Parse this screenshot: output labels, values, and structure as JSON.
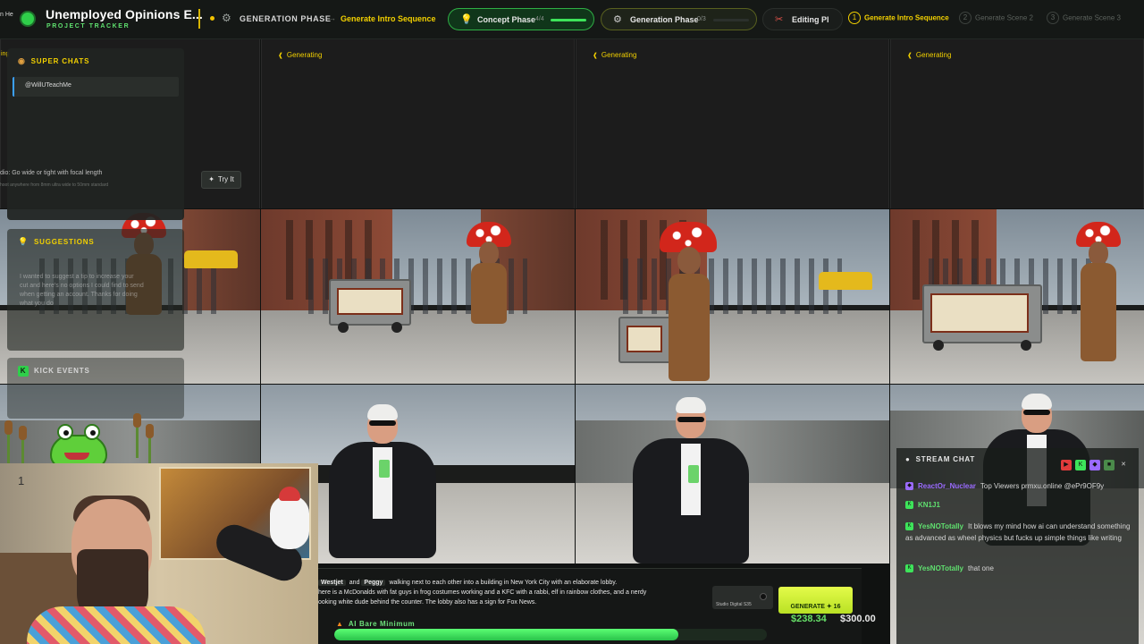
{
  "app": {
    "title": "Unemployed Opinions E...",
    "subtitle": "PROJECT TRACKER"
  },
  "topbar": {
    "phase_label": "GENERATION PHASE",
    "current_action": "Generate Intro Sequence",
    "pills": [
      {
        "label": "Concept Phase",
        "count": "4/4",
        "progress": 1.0
      },
      {
        "label": "Generation Phase",
        "count": "0/3",
        "progress": 0.0
      },
      {
        "label": "Editing Pl",
        "count": "",
        "progress": 0.0
      }
    ],
    "steps": [
      {
        "num": "1",
        "label": "Generate Intro Sequence",
        "state": "active"
      },
      {
        "num": "2",
        "label": "Generate Scene 2",
        "state": "idle"
      },
      {
        "num": "3",
        "label": "Generate Scene 3",
        "state": "idle"
      }
    ],
    "left_crumb": "n He"
  },
  "grid": {
    "generating_label": "Generating",
    "left_status": "ing"
  },
  "super_chats": {
    "title": "SUPER CHATS",
    "entries": [
      {
        "user": "@WillUTeachMe"
      }
    ]
  },
  "tip": {
    "text": "dio: Go wide or tight with focal length",
    "subtext": "hoot anywhere from 8mm ultra wide to 50mm standard",
    "try_label": "Try It"
  },
  "suggestions": {
    "title": "SUGGESTIONS",
    "lines": [
      "I wanted to suggest a tip to increase your",
      "cut and here's no options I could find to send",
      "when getting an account. Thanks for doing",
      "what you do"
    ]
  },
  "kick_events": {
    "title": "KICK EVENTS"
  },
  "webcam": {
    "overlay_digit": "1"
  },
  "chat": {
    "title": "STREAM CHAT",
    "messages": [
      {
        "platform": "twitch",
        "user": "ReactOr_Nuclear",
        "text": "Top Viewers prmxu.online @ePr9OF9y",
        "user_color": "#9b6bff"
      },
      {
        "platform": "kick",
        "user": "KN1J1",
        "text": "",
        "user_color": "#5fe06f"
      },
      {
        "platform": "kick",
        "user": "YesNOTotally",
        "text": "It blows my mind how ai can understand something as advanced as wheel physics but fucks up simple things like writing",
        "user_color": "#5fe06f"
      },
      {
        "platform": "kick",
        "user": "YesNOTotally",
        "text": "that one",
        "user_color": "#5fe06f"
      }
    ]
  },
  "prompt": {
    "mention_1": "Westjet",
    "joiner": "and",
    "mention_2": "Peggy",
    "line_1": "walking next to each other into a building in New York City with an elaborate lobby.",
    "line_2": "here is a McDonalds with fat guys in frog costumes working and a KFC with a rabbi, elf in rainbow clothes, and a nerdy",
    "line_3": "ooking white dude behind the counter. The lobby also has a sign for Fox News.",
    "model_label": "Studio Digital S35",
    "generate_label": "GENERATE",
    "generate_cost": "16"
  },
  "budget": {
    "name": "AI Bare Minimum",
    "spent": "$238.34",
    "total": "$300.00",
    "spent_value": 238.34,
    "total_value": 300.0
  },
  "colors": {
    "accent_green": "#3de45a",
    "accent_yellow": "#f2d000",
    "background": "#101211"
  }
}
